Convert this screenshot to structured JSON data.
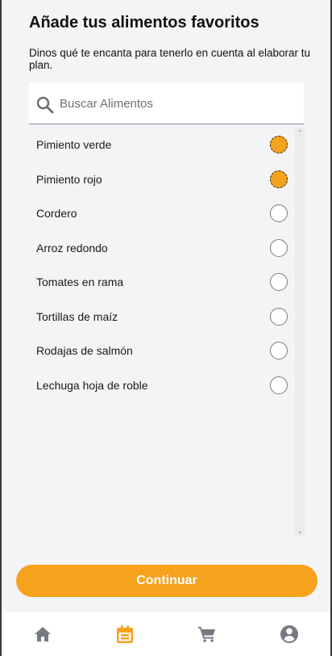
{
  "header": {
    "title": "Añade tus alimentos favoritos",
    "subtitle": "Dinos qué te encanta para tenerlo en cuenta al elaborar tu plan."
  },
  "search": {
    "placeholder": "Buscar Alimentos",
    "value": "",
    "icon": "search-icon"
  },
  "foods": [
    {
      "label": "Pimiento verde",
      "selected": true
    },
    {
      "label": "Pimiento rojo",
      "selected": true
    },
    {
      "label": "Cordero",
      "selected": false
    },
    {
      "label": "Arroz redondo",
      "selected": false
    },
    {
      "label": "Tomates en rama",
      "selected": false
    },
    {
      "label": "Tortillas de maíz",
      "selected": false
    },
    {
      "label": "Rodajas de salmón",
      "selected": false
    },
    {
      "label": "Lechuga hoja de roble",
      "selected": false
    }
  ],
  "actions": {
    "continue_label": "Continuar"
  },
  "nav": {
    "items": [
      {
        "icon": "home-icon",
        "active": false
      },
      {
        "icon": "calendar-icon",
        "active": true
      },
      {
        "icon": "cart-icon",
        "active": false
      },
      {
        "icon": "account-icon",
        "active": false
      }
    ]
  },
  "colors": {
    "accent": "#f7a21d",
    "nav_inactive": "#757a82",
    "background": "#f3f4f6"
  }
}
